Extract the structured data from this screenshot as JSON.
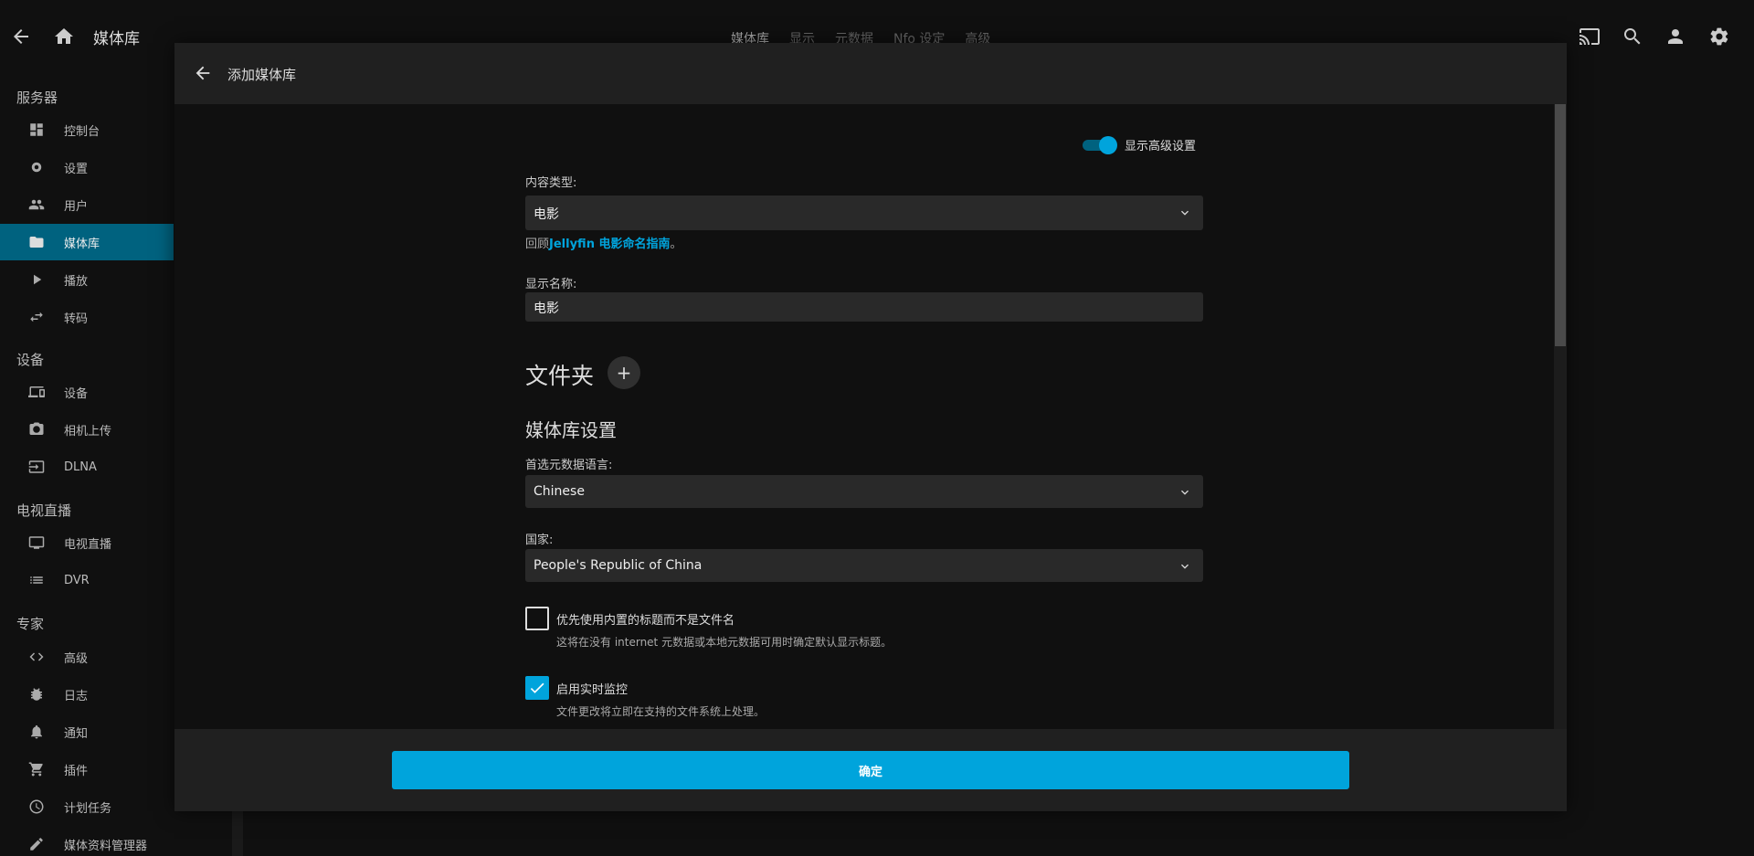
{
  "appbar": {
    "title": "媒体库",
    "tabs": [
      "媒体库",
      "显示",
      "元数据",
      "Nfo 设定",
      "高级"
    ]
  },
  "sidebar": {
    "sections": [
      {
        "label": "服务器",
        "items": [
          {
            "label": "控制台",
            "icon": "dashboard-icon"
          },
          {
            "label": "设置",
            "icon": "gear-icon"
          },
          {
            "label": "用户",
            "icon": "people-icon"
          },
          {
            "label": "媒体库",
            "icon": "folder-icon",
            "active": true
          },
          {
            "label": "播放",
            "icon": "play-icon"
          },
          {
            "label": "转码",
            "icon": "swap-icon"
          }
        ]
      },
      {
        "label": "设备",
        "items": [
          {
            "label": "设备",
            "icon": "devices-icon"
          },
          {
            "label": "相机上传",
            "icon": "camera-icon"
          },
          {
            "label": "DLNA",
            "icon": "input-icon"
          }
        ]
      },
      {
        "label": "电视直播",
        "items": [
          {
            "label": "电视直播",
            "icon": "tv-icon"
          },
          {
            "label": "DVR",
            "icon": "list-icon"
          }
        ]
      },
      {
        "label": "专家",
        "items": [
          {
            "label": "高级",
            "icon": "code-icon"
          },
          {
            "label": "日志",
            "icon": "bug-icon"
          },
          {
            "label": "通知",
            "icon": "bell-icon"
          },
          {
            "label": "插件",
            "icon": "cart-icon"
          },
          {
            "label": "计划任务",
            "icon": "clock-icon"
          },
          {
            "label": "媒体资料管理器",
            "icon": "pencil-icon"
          }
        ]
      }
    ]
  },
  "dialog": {
    "title": "添加媒体库",
    "advanced_toggle_label": "显示高级设置",
    "content_type_label": "内容类型:",
    "content_type_value": "电影",
    "guide_prefix": "回顾",
    "guide_link": "Jellyfin 电影命名指南",
    "guide_suffix": "。",
    "display_name_label": "显示名称:",
    "display_name_value": "电影",
    "folders_heading": "文件夹",
    "library_settings_heading": "媒体库设置",
    "metadata_language_label": "首选元数据语言:",
    "metadata_language_value": "Chinese",
    "country_label": "国家:",
    "country_value": "People's Republic of China",
    "prefer_embedded_title_label": "优先使用内置的标题而不是文件名",
    "prefer_embedded_title_desc": "这将在没有 internet 元数据或本地元数据可用时确定默认显示标题。",
    "realtime_monitor_label": "启用实时监控",
    "realtime_monitor_desc": "文件更改将立即在支持的文件系统上处理。",
    "ok_label": "确定"
  },
  "colors": {
    "accent": "#00a4dc",
    "active_nav": "#00627f"
  }
}
